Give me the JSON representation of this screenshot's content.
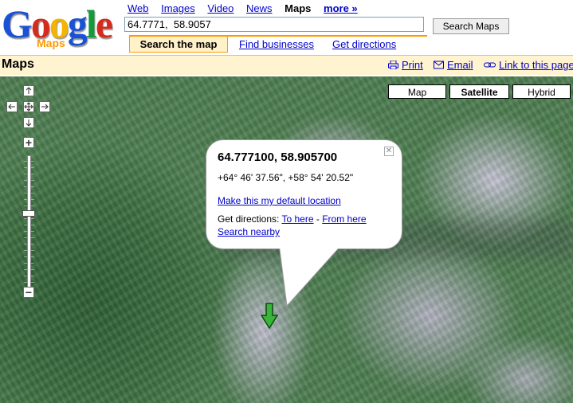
{
  "logo": {
    "word": "Google",
    "sub": "Maps"
  },
  "topnav": [
    "Web",
    "Images",
    "Video",
    "News",
    "Maps"
  ],
  "topnav_more": "more »",
  "search": {
    "value": "64.7771,  58.9057",
    "button": "Search Maps"
  },
  "search_tabs": [
    "Search the map",
    "Find businesses",
    "Get directions"
  ],
  "titlebar": {
    "title": "Maps",
    "print": "Print",
    "email": "Email",
    "link": "Link to this page"
  },
  "map_types": [
    "Map",
    "Satellite",
    "Hybrid"
  ],
  "selected_map_type": "Satellite",
  "zoom": {
    "plus": "+",
    "minus": "−"
  },
  "info": {
    "coords": "64.777100, 58.905700",
    "dms": "+64° 46' 37.56\", +58° 54' 20.52\"",
    "default_location": "Make this my default location",
    "directions_label": "Get directions:",
    "to_here": "To here",
    "sep": "-",
    "from_here": "From here",
    "nearby": "Search nearby"
  },
  "colors": {
    "accent": "#ff9900",
    "link": "#0000cc",
    "title_bg": "#fff3d0"
  },
  "icons": [
    "print-icon",
    "email-icon",
    "link-icon",
    "close-icon",
    "pan-arrows",
    "marker-arrow"
  ]
}
